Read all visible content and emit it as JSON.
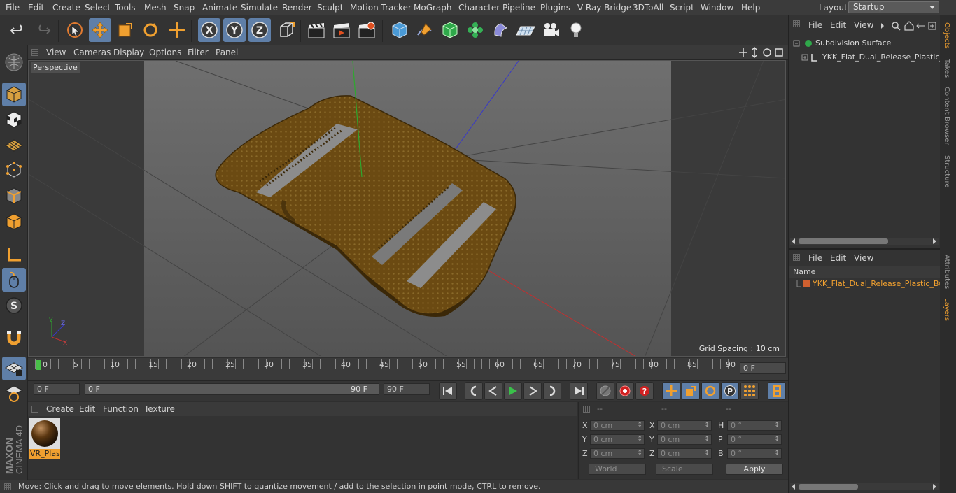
{
  "menu": [
    "File",
    "Edit",
    "Create",
    "Select",
    "Tools",
    "Mesh",
    "Snap",
    "Animate",
    "Simulate",
    "Render",
    "Sculpt",
    "Motion Tracker",
    "MoGraph",
    "Character",
    "Pipeline",
    "Plugins",
    "V-Ray Bridge",
    "3DToAll",
    "Script",
    "Window",
    "Help"
  ],
  "layout": {
    "label": "Layout:",
    "value": "Startup"
  },
  "viewport": {
    "menu": [
      "View",
      "Cameras",
      "Display",
      "Options",
      "Filter",
      "Panel"
    ],
    "camera": "Perspective",
    "grid_spacing": "Grid Spacing : 10 cm",
    "axis": {
      "x": "X",
      "y": "Y",
      "z": "Z"
    }
  },
  "timeline": {
    "ticks": [
      "0",
      "5",
      "10",
      "15",
      "20",
      "25",
      "30",
      "35",
      "40",
      "45",
      "50",
      "55",
      "60",
      "65",
      "70",
      "75",
      "80",
      "85",
      "90"
    ],
    "current": "0 F",
    "start": "0 F",
    "range_start": "0 F",
    "range_end": "90 F",
    "end": "90 F"
  },
  "materials": {
    "menu": [
      "Create",
      "Edit",
      "Function",
      "Texture"
    ],
    "item": "VR_Plast"
  },
  "coords": {
    "headers": [
      "--",
      "--",
      "--"
    ],
    "rows": [
      {
        "a": "X",
        "av": "0 cm",
        "b": "X",
        "bv": "0 cm",
        "c": "H",
        "cv": "0 °"
      },
      {
        "a": "Y",
        "av": "0 cm",
        "b": "Y",
        "bv": "0 cm",
        "c": "P",
        "cv": "0 °"
      },
      {
        "a": "Z",
        "av": "0 cm",
        "b": "Z",
        "bv": "0 cm",
        "c": "B",
        "cv": "0 °"
      }
    ],
    "world": "World",
    "scale": "Scale",
    "apply": "Apply"
  },
  "status": "Move: Click and drag to move elements. Hold down SHIFT to quantize movement / add to the selection in point mode, CTRL to remove.",
  "objects": {
    "menu": [
      "File",
      "Edit",
      "View"
    ],
    "items": [
      "Subdivision Surface",
      "YKK_Flat_Dual_Release_Plastic_Bu"
    ]
  },
  "layers": {
    "menu": [
      "File",
      "Edit",
      "View"
    ],
    "header": "Name",
    "item": "YKK_Flat_Dual_Release_Plastic_Buc"
  },
  "sidetabs": {
    "top": [
      "Objects",
      "Takes",
      "Content Browser",
      "Structure"
    ],
    "bottom": [
      "Attributes",
      "Layers"
    ]
  },
  "brand": {
    "maxon": "MAXON",
    "cinema": "CINEMA 4D"
  },
  "colors": {
    "accent": "#f0a030",
    "active": "#5f7fa8",
    "buckle": "#6b4a12"
  }
}
